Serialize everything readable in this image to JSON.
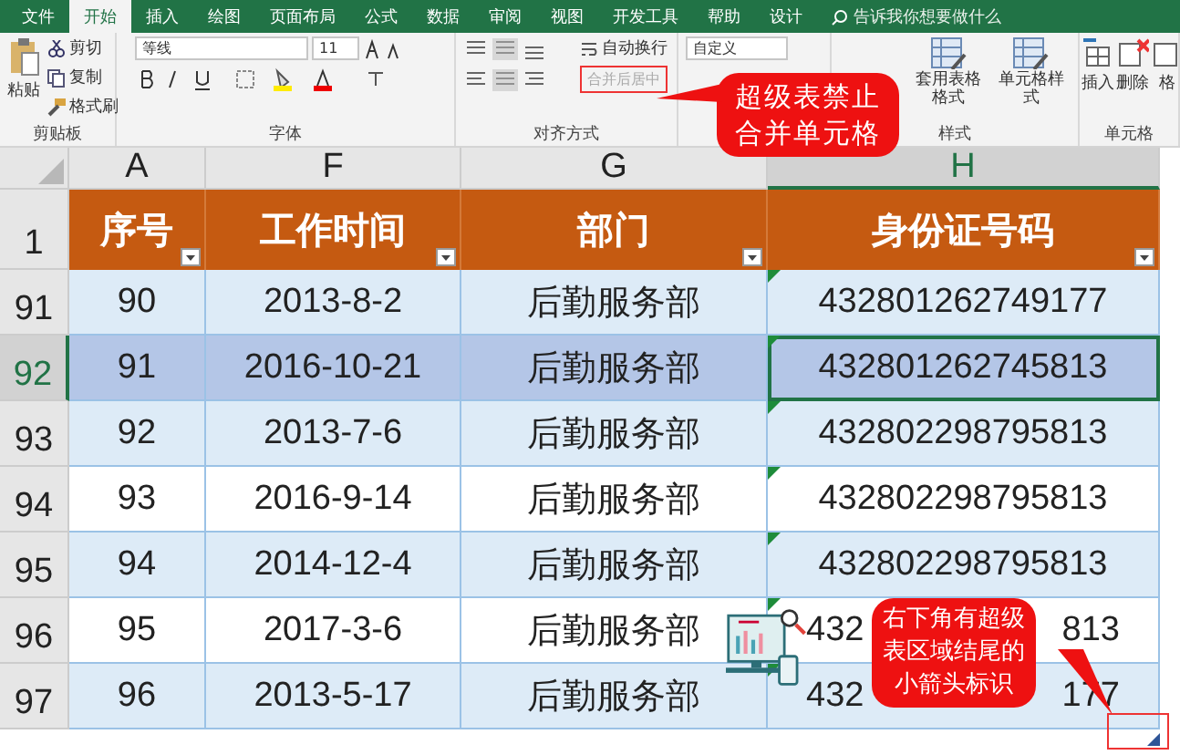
{
  "menu_tabs": [
    {
      "label": "文件",
      "selected": false
    },
    {
      "label": "开始",
      "selected": true
    },
    {
      "label": "插入",
      "selected": false
    },
    {
      "label": "绘图",
      "selected": false
    },
    {
      "label": "页面布局",
      "selected": false
    },
    {
      "label": "公式",
      "selected": false
    },
    {
      "label": "数据",
      "selected": false
    },
    {
      "label": "审阅",
      "selected": false
    },
    {
      "label": "视图",
      "selected": false
    },
    {
      "label": "开发工具",
      "selected": false
    },
    {
      "label": "帮助",
      "selected": false
    },
    {
      "label": "设计",
      "selected": false
    }
  ],
  "tell_me": {
    "placeholder": "告诉我你想要做什么"
  },
  "ribbon": {
    "clipboard": {
      "paste": "粘贴",
      "cut": "剪切",
      "copy": "复制",
      "format_painter": "格式刷",
      "label": "剪贴板"
    },
    "font": {
      "name": "等线",
      "size": "11",
      "label": "字体"
    },
    "alignment": {
      "wrap": "自动换行",
      "merge": "合并后居中",
      "merge_disabled": true,
      "label": "对齐方式"
    },
    "number": {
      "format": "自定义"
    },
    "styles": {
      "table_format": "套用表格格式",
      "cell_styles": "单元格样式",
      "label": "样式"
    },
    "cells": {
      "insert": "插入",
      "delete": "删除",
      "format": "格",
      "label": "单元格"
    }
  },
  "columns": [
    {
      "letter": "A",
      "selected": false
    },
    {
      "letter": "F",
      "selected": false
    },
    {
      "letter": "G",
      "selected": false
    },
    {
      "letter": "H",
      "selected": true
    }
  ],
  "header_row": {
    "number": "1",
    "cells": [
      "序号",
      "工作时间",
      "部门",
      "身份证号码"
    ]
  },
  "rows": [
    {
      "number": "91",
      "selected": false,
      "banded": true,
      "cells": [
        "90",
        "2013-8-2",
        "后勤服务部",
        "432801262749177"
      ]
    },
    {
      "number": "92",
      "selected": true,
      "banded": true,
      "cells": [
        "91",
        "2016-10-21",
        "后勤服务部",
        "432801262745813"
      ]
    },
    {
      "number": "93",
      "selected": false,
      "banded": true,
      "cells": [
        "92",
        "2013-7-6",
        "后勤服务部",
        "432802298795813"
      ]
    },
    {
      "number": "94",
      "selected": false,
      "banded": false,
      "cells": [
        "93",
        "2016-9-14",
        "后勤服务部",
        "432802298795813"
      ]
    },
    {
      "number": "95",
      "selected": false,
      "banded": true,
      "cells": [
        "94",
        "2014-12-4",
        "后勤服务部",
        "432802298795813"
      ]
    },
    {
      "number": "96",
      "selected": false,
      "banded": false,
      "cells": [
        "95",
        "2017-3-6",
        "后勤服务部",
        [
          "432",
          "813"
        ]
      ]
    },
    {
      "number": "97",
      "selected": false,
      "banded": true,
      "cells": [
        "96",
        "2013-5-17",
        "后勤服务部",
        [
          "432",
          "177"
        ]
      ]
    }
  ],
  "callouts": [
    {
      "kind": "top",
      "lines": [
        "超级表禁止",
        "合并单元格"
      ]
    },
    {
      "kind": "bottom",
      "lines": [
        "右下角有超级",
        "表区域结尾的",
        "小箭头标识"
      ]
    }
  ]
}
